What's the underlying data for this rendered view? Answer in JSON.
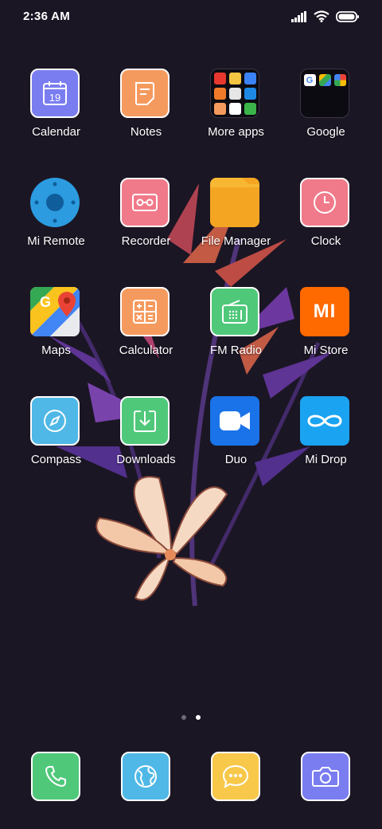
{
  "status_bar": {
    "time": "2:36 AM"
  },
  "home": {
    "rows": [
      [
        {
          "label": "Calendar",
          "color": "#7a7df0",
          "icon": "calendar-icon",
          "date": "19"
        },
        {
          "label": "Notes",
          "color": "#f59a5e",
          "icon": "notes-icon"
        },
        {
          "label": "More apps",
          "color": "#0d0b12",
          "icon": "folder-icon"
        },
        {
          "label": "Google",
          "color": "#0d0b12",
          "icon": "folder-icon"
        }
      ],
      [
        {
          "label": "Mi Remote",
          "color": "#2c9be0",
          "icon": "remote-icon"
        },
        {
          "label": "Recorder",
          "color": "#f07a8a",
          "icon": "cassette-icon"
        },
        {
          "label": "File Manager",
          "color": "#f4a623",
          "icon": "folder-icon"
        },
        {
          "label": "Clock",
          "color": "#f07a8a",
          "icon": "clock-icon"
        }
      ],
      [
        {
          "label": "Maps",
          "color": "#ffffff",
          "icon": "google-maps-icon"
        },
        {
          "label": "Calculator",
          "color": "#f59a5e",
          "icon": "calculator-icon"
        },
        {
          "label": "FM Radio",
          "color": "#4fc87a",
          "icon": "radio-icon"
        },
        {
          "label": "Mi Store",
          "color": "#ff6a00",
          "icon": "mi-logo-icon",
          "logo_text": "MI"
        }
      ],
      [
        {
          "label": "Compass",
          "color": "#4fb8e6",
          "icon": "compass-icon"
        },
        {
          "label": "Downloads",
          "color": "#4fc87a",
          "icon": "download-icon"
        },
        {
          "label": "Duo",
          "color": "#1a73e8",
          "icon": "video-camera-icon"
        },
        {
          "label": "Mi Drop",
          "color": "#1aa3f0",
          "icon": "infinity-icon"
        }
      ]
    ],
    "page_indicator": {
      "count": 2,
      "active": 2
    }
  },
  "dock": [
    {
      "name": "phone",
      "color": "#4fc87a",
      "icon": "phone-icon"
    },
    {
      "name": "browser",
      "color": "#4fb8e6",
      "icon": "globe-icon"
    },
    {
      "name": "messages",
      "color": "#f7c84a",
      "icon": "chat-bubble-icon"
    },
    {
      "name": "camera",
      "color": "#7a7df0",
      "icon": "camera-icon"
    }
  ]
}
